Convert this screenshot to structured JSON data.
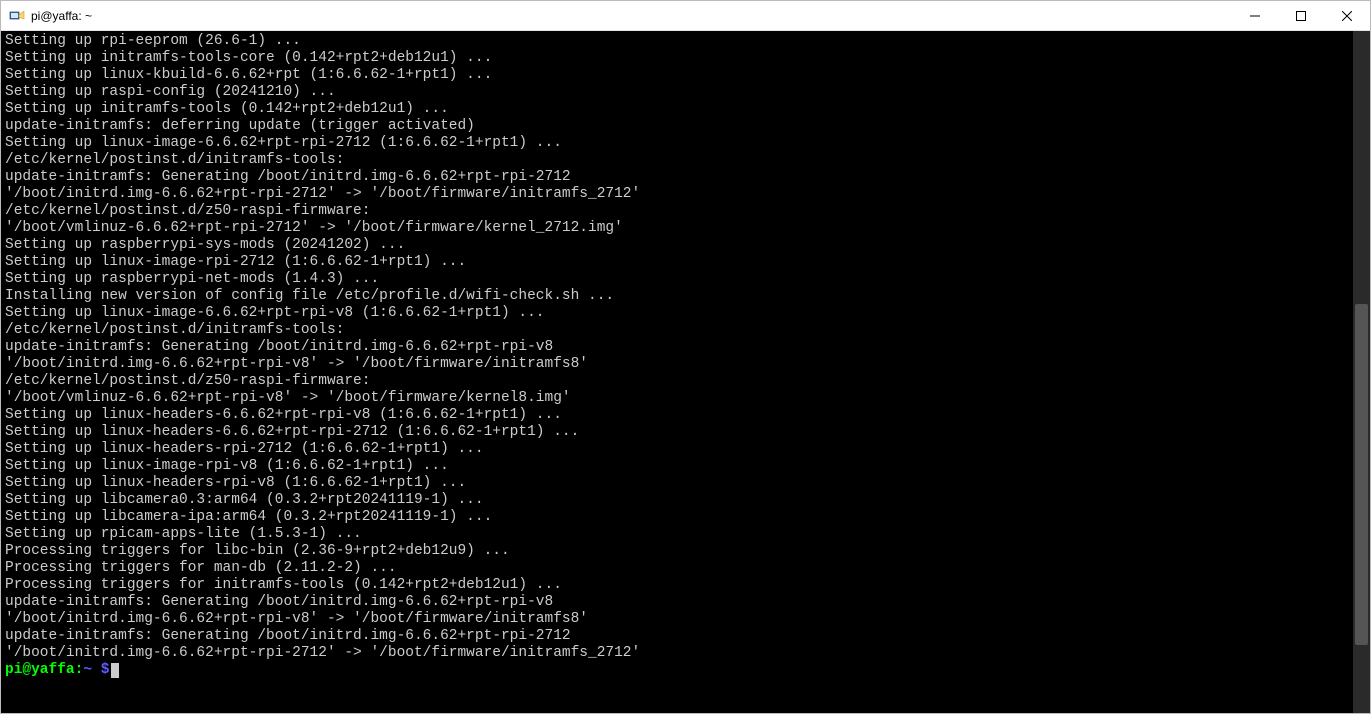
{
  "window": {
    "title": "pi@yaffa: ~"
  },
  "terminal": {
    "lines": [
      "Setting up rpi-eeprom (26.6-1) ...",
      "Setting up initramfs-tools-core (0.142+rpt2+deb12u1) ...",
      "Setting up linux-kbuild-6.6.62+rpt (1:6.6.62-1+rpt1) ...",
      "Setting up raspi-config (20241210) ...",
      "Setting up initramfs-tools (0.142+rpt2+deb12u1) ...",
      "update-initramfs: deferring update (trigger activated)",
      "Setting up linux-image-6.6.62+rpt-rpi-2712 (1:6.6.62-1+rpt1) ...",
      "/etc/kernel/postinst.d/initramfs-tools:",
      "update-initramfs: Generating /boot/initrd.img-6.6.62+rpt-rpi-2712",
      "'/boot/initrd.img-6.6.62+rpt-rpi-2712' -> '/boot/firmware/initramfs_2712'",
      "/etc/kernel/postinst.d/z50-raspi-firmware:",
      "'/boot/vmlinuz-6.6.62+rpt-rpi-2712' -> '/boot/firmware/kernel_2712.img'",
      "Setting up raspberrypi-sys-mods (20241202) ...",
      "Setting up linux-image-rpi-2712 (1:6.6.62-1+rpt1) ...",
      "Setting up raspberrypi-net-mods (1.4.3) ...",
      "Installing new version of config file /etc/profile.d/wifi-check.sh ...",
      "Setting up linux-image-6.6.62+rpt-rpi-v8 (1:6.6.62-1+rpt1) ...",
      "/etc/kernel/postinst.d/initramfs-tools:",
      "update-initramfs: Generating /boot/initrd.img-6.6.62+rpt-rpi-v8",
      "'/boot/initrd.img-6.6.62+rpt-rpi-v8' -> '/boot/firmware/initramfs8'",
      "/etc/kernel/postinst.d/z50-raspi-firmware:",
      "'/boot/vmlinuz-6.6.62+rpt-rpi-v8' -> '/boot/firmware/kernel8.img'",
      "Setting up linux-headers-6.6.62+rpt-rpi-v8 (1:6.6.62-1+rpt1) ...",
      "Setting up linux-headers-6.6.62+rpt-rpi-2712 (1:6.6.62-1+rpt1) ...",
      "Setting up linux-headers-rpi-2712 (1:6.6.62-1+rpt1) ...",
      "Setting up linux-image-rpi-v8 (1:6.6.62-1+rpt1) ...",
      "Setting up linux-headers-rpi-v8 (1:6.6.62-1+rpt1) ...",
      "Setting up libcamera0.3:arm64 (0.3.2+rpt20241119-1) ...",
      "Setting up libcamera-ipa:arm64 (0.3.2+rpt20241119-1) ...",
      "Setting up rpicam-apps-lite (1.5.3-1) ...",
      "Processing triggers for libc-bin (2.36-9+rpt2+deb12u9) ...",
      "Processing triggers for man-db (2.11.2-2) ...",
      "Processing triggers for initramfs-tools (0.142+rpt2+deb12u1) ...",
      "update-initramfs: Generating /boot/initrd.img-6.6.62+rpt-rpi-v8",
      "'/boot/initrd.img-6.6.62+rpt-rpi-v8' -> '/boot/firmware/initramfs8'",
      "update-initramfs: Generating /boot/initrd.img-6.6.62+rpt-rpi-2712",
      "'/boot/initrd.img-6.6.62+rpt-rpi-2712' -> '/boot/firmware/initramfs_2712'"
    ],
    "prompt": {
      "user_host": "pi@yaffa",
      "colon": ":",
      "cwd": "~",
      "dollar": " $"
    }
  }
}
